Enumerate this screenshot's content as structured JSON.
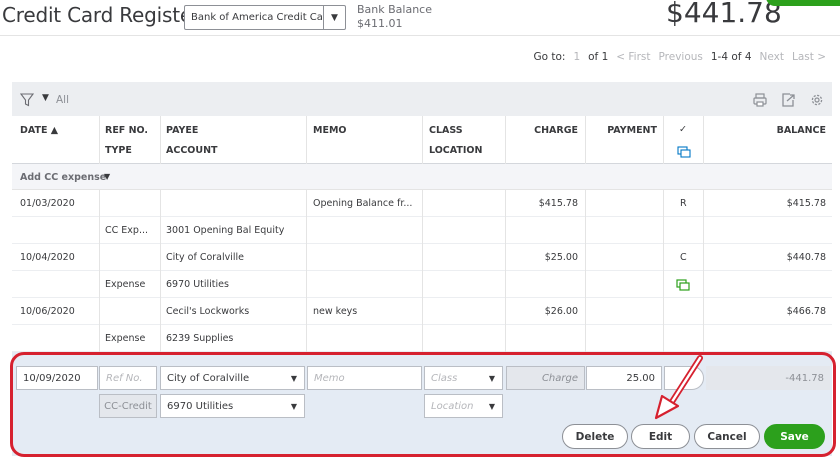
{
  "header": {
    "title": "Credit Card Register",
    "account_selected": "Bank of America Credit Car",
    "bank_balance_label": "Bank Balance",
    "bank_balance_value": "$411.01",
    "ending_balance": "$441.78"
  },
  "pager": {
    "goto_label": "Go to:",
    "page": "1",
    "of_label": "of 1",
    "first": "< First",
    "previous": "Previous",
    "range": "1-4 of 4",
    "next": "Next",
    "last": "Last >"
  },
  "toolbar": {
    "filter_value": "All",
    "icons": [
      "filter-icon",
      "print-icon",
      "export-icon",
      "gear-icon"
    ]
  },
  "columns": {
    "date": "DATE ▲",
    "ref_no": "REF NO.",
    "type": "TYPE",
    "payee": "PAYEE",
    "account": "ACCOUNT",
    "memo": "MEMO",
    "class": "CLASS",
    "location": "LOCATION",
    "charge": "CHARGE",
    "payment": "PAYMENT",
    "check": "✓",
    "balance": "BALANCE"
  },
  "add_expense_label": "Add CC expense",
  "transactions": [
    {
      "date": "01/03/2020",
      "type": "CC Exp...",
      "payee": "",
      "account": "3001 Opening Bal Equity",
      "memo": "Opening Balance fr...",
      "charge": "$415.78",
      "payment": "",
      "status": "R",
      "balance": "$415.78"
    },
    {
      "date": "10/04/2020",
      "type": "Expense",
      "payee": "City of Coralville",
      "account": "6970 Utilities",
      "memo": "",
      "charge": "$25.00",
      "payment": "",
      "status": "C",
      "balance": "$440.78"
    },
    {
      "date": "10/06/2020",
      "type": "Expense",
      "payee": "Cecil's Lockworks",
      "account": "6239 Supplies",
      "memo": "new keys",
      "charge": "$26.00",
      "payment": "",
      "status": "",
      "balance": "$466.78"
    }
  ],
  "edit_row": {
    "date": "10/09/2020",
    "ref_placeholder": "Ref No.",
    "payee": "City of Coralville",
    "memo_placeholder": "Memo",
    "class_placeholder": "Class",
    "charge_placeholder": "Charge",
    "payment": "25.00",
    "balance": "-441.78",
    "type": "CC-Credit",
    "account": "6970 Utilities",
    "location_placeholder": "Location"
  },
  "buttons": {
    "delete": "Delete",
    "edit": "Edit",
    "cancel": "Cancel",
    "save": "Save"
  },
  "colors": {
    "accent_green": "#2ca01c",
    "annotation_red": "#d6212f",
    "edit_bg": "#e4ebf4"
  }
}
